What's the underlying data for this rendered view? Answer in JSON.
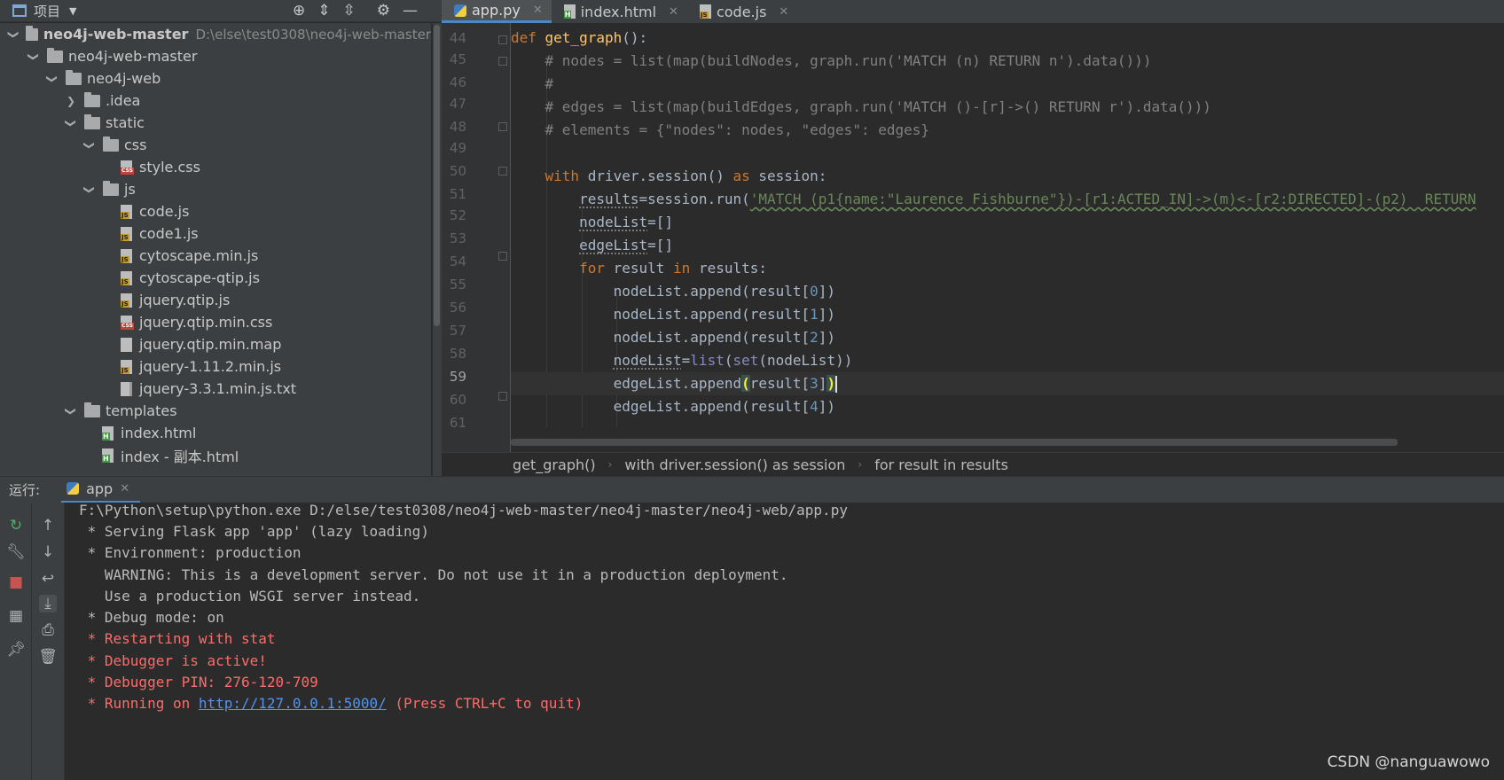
{
  "project_header": {
    "title": "项目"
  },
  "tabs": [
    {
      "label": "app.py",
      "icon": "python-file-icon"
    },
    {
      "label": "index.html",
      "icon": "html-file-icon"
    },
    {
      "label": "code.js",
      "icon": "js-file-icon"
    }
  ],
  "tree": {
    "root": {
      "label": "neo4j-web-master",
      "path": "D:\\else\\test0308\\neo4j-web-master"
    },
    "items": [
      {
        "label": "neo4j-web-master"
      },
      {
        "label": "neo4j-web"
      },
      {
        "label": ".idea"
      },
      {
        "label": "static"
      },
      {
        "label": "css"
      },
      {
        "label": "style.css"
      },
      {
        "label": "js"
      },
      {
        "label": "code.js"
      },
      {
        "label": "code1.js"
      },
      {
        "label": "cytoscape.min.js"
      },
      {
        "label": "cytoscape-qtip.js"
      },
      {
        "label": "jquery.qtip.js"
      },
      {
        "label": "jquery.qtip.min.css"
      },
      {
        "label": "jquery.qtip.min.map"
      },
      {
        "label": "jquery-1.11.2.min.js"
      },
      {
        "label": "jquery-3.3.1.min.js.txt"
      },
      {
        "label": "templates"
      },
      {
        "label": "index.html"
      },
      {
        "label": "index - 副本.html"
      }
    ]
  },
  "editor": {
    "line_numbers": [
      "44",
      "45",
      "46",
      "47",
      "48",
      "49",
      "50",
      "51",
      "52",
      "53",
      "54",
      "55",
      "56",
      "57",
      "58",
      "59",
      "60",
      "61"
    ],
    "current_line": "59"
  },
  "breadcrumbs": [
    "get_graph()",
    "with driver.session() as session",
    "for result in results"
  ],
  "run": {
    "label": "运行:",
    "tab": "app",
    "console": [
      "F:\\Python\\setup\\python.exe D:/else/test0308/neo4j-web-master/neo4j-master/neo4j-web/app.py",
      " * Serving Flask app 'app' (lazy loading)",
      " * Environment: production",
      "   WARNING: This is a development server. Do not use it in a production deployment.",
      "   Use a production WSGI server instead.",
      " * Debug mode: on",
      " * Restarting with stat",
      " * Debugger is active!",
      " * Debugger PIN: 276-120-709"
    ],
    "running": {
      "prefix": " * Running on ",
      "url": "http://127.0.0.1:5000/",
      "suffix": " (Press CTRL+C to quit)"
    }
  },
  "watermark": "CSDN @nanguawowo",
  "colors": {
    "accent": "#4a88c7",
    "error_text": "#ff6b68",
    "keyword": "#cc7832",
    "function": "#ffc66d",
    "string": "#6a8759",
    "number": "#6897bb"
  }
}
